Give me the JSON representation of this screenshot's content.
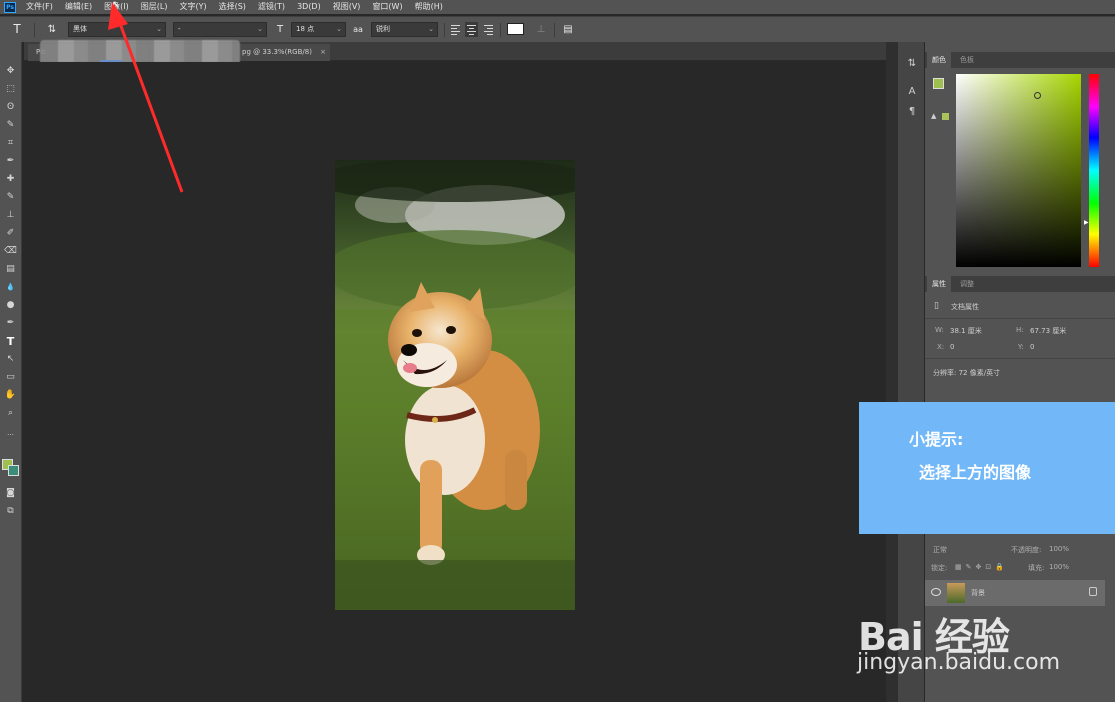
{
  "menu": {
    "logo": "Ps",
    "items": [
      "文件(F)",
      "编辑(E)",
      "图像(I)",
      "图层(L)",
      "文字(Y)",
      "选择(S)",
      "滤镜(T)",
      "3D(D)",
      "视图(V)",
      "窗口(W)",
      "帮助(H)"
    ]
  },
  "options": {
    "tool_glyph": "T",
    "orient_glyph": "⇅",
    "font_family": "黑体",
    "font_style": "-",
    "size_glyph": "T",
    "font_size": "18 点",
    "aa_glyph": "aa",
    "antialias": "锐利",
    "text_color": "#ffffff"
  },
  "tabs": [
    {
      "label": "Pic"
    },
    {
      "label": "pg @ 33.3%(RGB/8)"
    }
  ],
  "toolbar": {
    "tools": [
      "✥",
      "⬚",
      "ʘ",
      "✎",
      "⌗",
      "✒",
      "✚",
      "✎",
      "⊥",
      "✐",
      "⌫",
      "▤",
      "💧",
      "●",
      "✒",
      "T",
      "↖",
      "▭",
      "✋",
      "⌕",
      "···"
    ]
  },
  "color_panel": {
    "tabs": [
      "颜色",
      "色板"
    ],
    "fg_color": "#9fbf4e",
    "bg_color": "#3c8c7a",
    "hue_color": "#a6d600"
  },
  "properties_panel": {
    "tabs": [
      "属性",
      "调整"
    ],
    "title": "文档属性",
    "w_label": "W:",
    "w_value": "38.1 厘米",
    "h_label": "H:",
    "h_value": "67.73 厘米",
    "x_label": "X:",
    "x_value": "0",
    "y_label": "Y:",
    "y_value": "0",
    "resolution": "分辨率: 72 像素/英寸"
  },
  "tip": {
    "title": "小提示:",
    "text": "选择上方的图像"
  },
  "layers_panel": {
    "blend_mode": "正常",
    "opacity_label": "不透明度:",
    "opacity_value": "100%",
    "lock_label": "锁定:",
    "fill_label": "填充:",
    "fill_value": "100%",
    "layer_name": "背景"
  },
  "watermark": {
    "logo": "Bai 经验",
    "url": "jingyan.baidu.com"
  }
}
